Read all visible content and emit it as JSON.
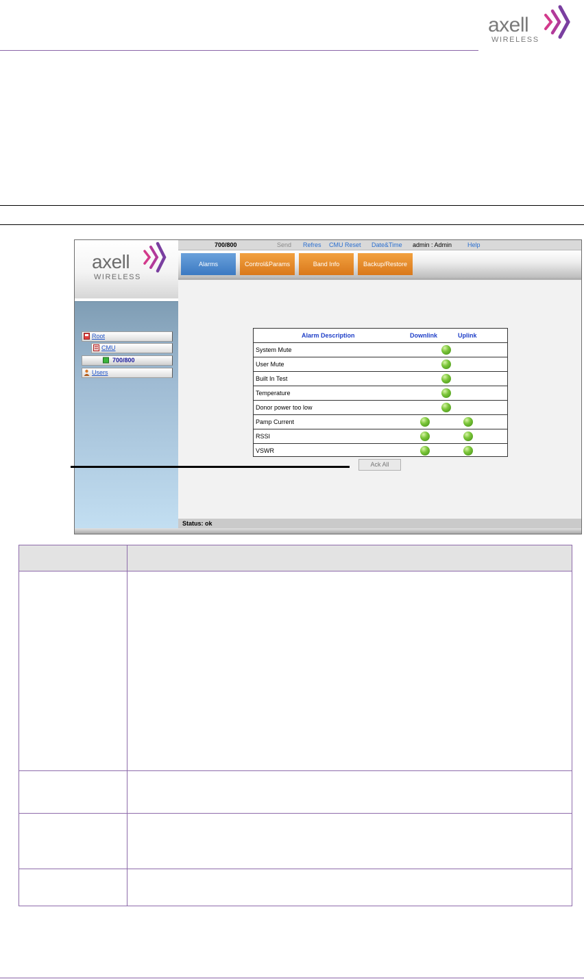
{
  "doc_header": {
    "logo_main": "axell",
    "logo_sub": "WIRELESS"
  },
  "screenshot": {
    "sidebar": {
      "logo_main": "axell",
      "logo_sub": "WIRELESS",
      "tree": [
        {
          "label": "Root"
        },
        {
          "label": "CMU"
        },
        {
          "label": "700/800"
        },
        {
          "label": "Users"
        }
      ]
    },
    "topbar": {
      "node": "700/800",
      "send": "Send",
      "refresh": "Refres",
      "cmu_reset": "CMU Reset",
      "datetime": "Date&Time",
      "user": "admin : Admin",
      "help": "Help"
    },
    "tabs": [
      {
        "label": "Alarms"
      },
      {
        "label": "Control&Params"
      },
      {
        "label": "Band Info"
      },
      {
        "label": "Backup/Restore"
      }
    ],
    "alarm_table": {
      "headers": {
        "description": "Alarm Description",
        "downlink": "Downlink",
        "uplink": "Uplink"
      },
      "rows": [
        {
          "label": "System Mute"
        },
        {
          "label": "User Mute"
        },
        {
          "label": "Built In Test"
        },
        {
          "label": "Temperature"
        },
        {
          "label": "Donor power too low"
        },
        {
          "label": "Pamp Current"
        },
        {
          "label": "RSSI"
        },
        {
          "label": "VSWR"
        }
      ]
    },
    "ack_all": "Ack All",
    "status": "Status: ok"
  },
  "colors": {
    "brand_purple": "#8a64a8",
    "tab_blue": "#3b79c2",
    "tab_orange": "#d9781b",
    "led_green": "#7cc63a"
  }
}
